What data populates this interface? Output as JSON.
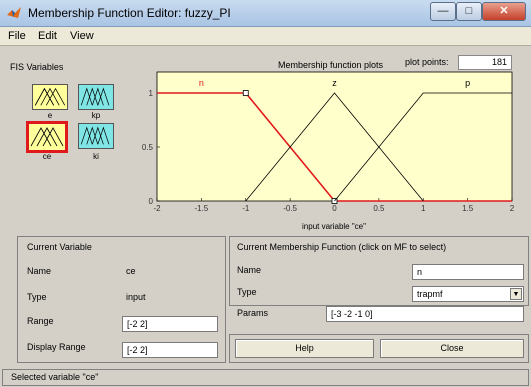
{
  "window": {
    "title": "Membership Function Editor: fuzzy_PI"
  },
  "menu": [
    "File",
    "Edit",
    "View"
  ],
  "fis_variables": {
    "label": "FIS Variables",
    "items": [
      {
        "name": "e",
        "color": "#ffff9c",
        "selected": false
      },
      {
        "name": "kp",
        "color": "#7fe5e5",
        "selected": false
      },
      {
        "name": "ce",
        "color": "#ffff9c",
        "selected": true
      },
      {
        "name": "ki",
        "color": "#7fe5e5",
        "selected": false
      }
    ]
  },
  "plot": {
    "title": "Membership function plots",
    "plot_points_label": "plot points:",
    "plot_points_value": "181"
  },
  "chart_data": {
    "type": "line",
    "xlabel": "input variable \"ce\"",
    "ylabel": "",
    "xlim": [
      -2,
      2
    ],
    "ylim": [
      0,
      1
    ],
    "xticks": [
      "-2",
      "-1.5",
      "-1",
      "-0.5",
      "0",
      "0.5",
      "1",
      "1.5",
      "2"
    ],
    "yticks": [
      "0",
      "0.5",
      "1"
    ],
    "series": [
      {
        "name": "n",
        "color": "#e0191c",
        "x": [
          -2,
          -1,
          0,
          2
        ],
        "y": [
          1,
          1,
          0,
          0
        ]
      },
      {
        "name": "z",
        "color": "#000000",
        "x": [
          -1,
          0,
          1
        ],
        "y": [
          0,
          1,
          0
        ]
      },
      {
        "name": "p",
        "color": "#000000",
        "x": [
          0,
          1,
          2
        ],
        "y": [
          0,
          1,
          1
        ]
      }
    ]
  },
  "current_variable": {
    "heading": "Current Variable",
    "name_label": "Name",
    "name_value": "ce",
    "type_label": "Type",
    "type_value": "input",
    "range_label": "Range",
    "range_value": "[-2 2]",
    "display_range_label": "Display Range",
    "display_range_value": "[-2 2]"
  },
  "current_mf": {
    "heading": "Current Membership Function (click on MF to select)",
    "name_label": "Name",
    "name_value": "n",
    "type_label": "Type",
    "type_value": "trapmf",
    "params_label": "Params",
    "params_value": "[-3 -2 -1 0]"
  },
  "buttons": {
    "help": "Help",
    "close": "Close"
  },
  "status": "Selected variable \"ce\""
}
